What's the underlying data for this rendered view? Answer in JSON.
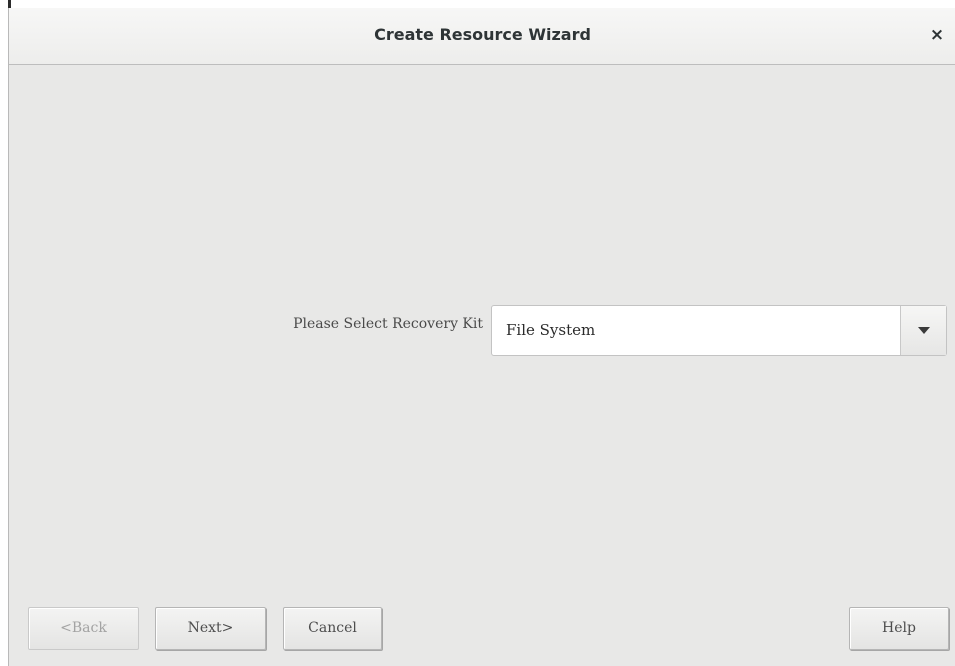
{
  "window": {
    "title": "Create Resource Wizard",
    "close_label": "×"
  },
  "form": {
    "recovery_kit_label": "Please Select Recovery Kit",
    "recovery_kit_value": "File System",
    "dropdown_icon": "chevron-down-icon"
  },
  "buttons": {
    "back_label": "<Back",
    "next_label": "Next>",
    "cancel_label": "Cancel",
    "help_label": "Help"
  },
  "colors": {
    "background": "#e8e8e7",
    "titlebar": "#f2f2f1",
    "disabled_text": "#a3a3a3"
  }
}
